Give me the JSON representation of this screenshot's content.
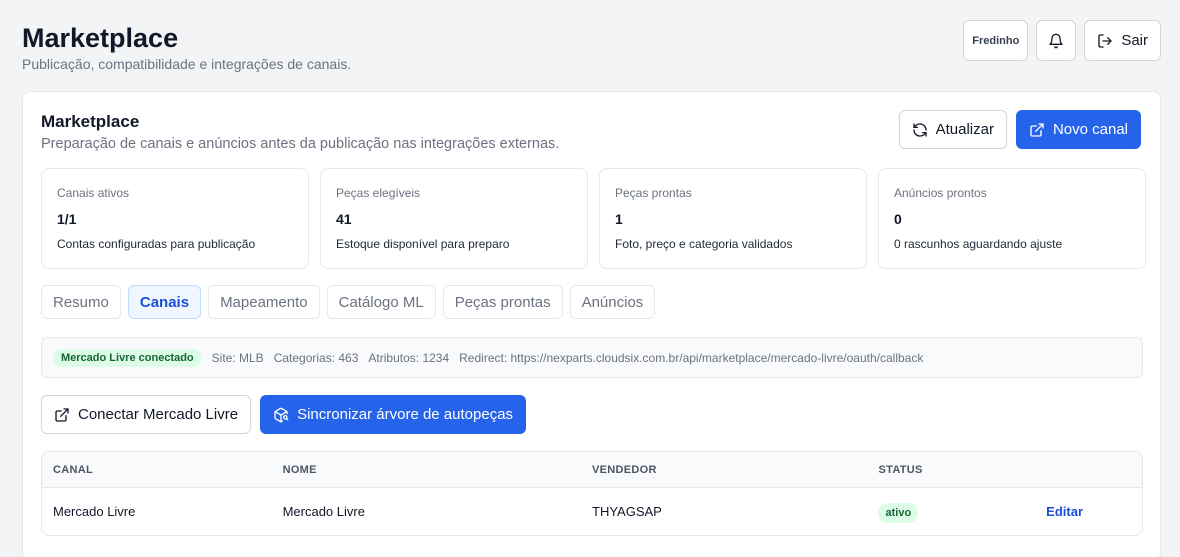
{
  "header": {
    "title": "Marketplace",
    "subtitle": "Publicação, compatibilidade e integrações de canais."
  },
  "top_actions": {
    "user": "Fredinho",
    "notifications_icon": "bell-icon",
    "logout_label": "Sair",
    "logout_icon": "logout-icon"
  },
  "card": {
    "title": "Marketplace",
    "subtitle": "Preparação de canais e anúncios antes da publicação nas integrações externas.",
    "refresh_label": "Atualizar",
    "new_channel_label": "Novo canal"
  },
  "stats": [
    {
      "label": "Canais ativos",
      "value": "1/1",
      "desc": "Contas configuradas para publicação"
    },
    {
      "label": "Peças elegíveis",
      "value": "41",
      "desc": "Estoque disponível para preparo"
    },
    {
      "label": "Peças prontas",
      "value": "1",
      "desc": "Foto, preço e categoria validados"
    },
    {
      "label": "Anúncios prontos",
      "value": "0",
      "desc": "0 rascunhos aguardando ajuste"
    }
  ],
  "tabs": [
    {
      "label": "Resumo",
      "active": false
    },
    {
      "label": "Canais",
      "active": true
    },
    {
      "label": "Mapeamento",
      "active": false
    },
    {
      "label": "Catálogo ML",
      "active": false
    },
    {
      "label": "Peças prontas",
      "active": false
    },
    {
      "label": "Anúncios",
      "active": false
    }
  ],
  "info": {
    "badge": "Mercado Livre conectado",
    "site": "Site: MLB",
    "categories": "Categorias: 463",
    "attributes": "Atributos: 1234",
    "redirect": "Redirect: https://nexparts.cloudsix.com.br/api/marketplace/mercado-livre/oauth/callback"
  },
  "actions": {
    "connect_label": "Conectar Mercado Livre",
    "sync_label": "Sincronizar árvore de autopeças"
  },
  "table": {
    "headers": [
      "CANAL",
      "NOME",
      "VENDEDOR",
      "STATUS"
    ],
    "rows": [
      {
        "canal": "Mercado Livre",
        "nome": "Mercado Livre",
        "vendedor": "THYAGSAP",
        "status": "ativo",
        "action": "Editar"
      }
    ]
  },
  "colors": {
    "primary": "#2563eb",
    "success_bg": "#dcfce7",
    "success_text": "#166534"
  }
}
